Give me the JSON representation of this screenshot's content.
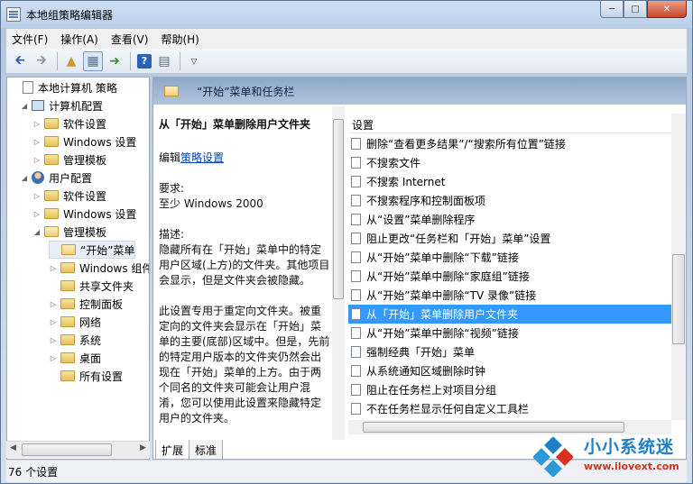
{
  "window": {
    "title": "本地组策略编辑器"
  },
  "menu": [
    "文件(F)",
    "操作(A)",
    "查看(V)",
    "帮助(H)"
  ],
  "tree": [
    {
      "label": "本地计算机 策略",
      "level": 0,
      "icon": "doc-icon",
      "tw": ""
    },
    {
      "label": "计算机配置",
      "level": 1,
      "icon": "computer-icon",
      "tw": "◢"
    },
    {
      "label": "软件设置",
      "level": 2,
      "icon": "folder-icon",
      "tw": "▷"
    },
    {
      "label": "Windows 设置",
      "level": 2,
      "icon": "folder-icon",
      "tw": "▷"
    },
    {
      "label": "管理模板",
      "level": 2,
      "icon": "folder-icon",
      "tw": "▷"
    },
    {
      "label": "用户配置",
      "level": 1,
      "icon": "user-icon",
      "tw": "◢"
    },
    {
      "label": "软件设置",
      "level": 2,
      "icon": "folder-icon",
      "tw": "▷"
    },
    {
      "label": "Windows 设置",
      "level": 2,
      "icon": "folder-icon",
      "tw": "▷"
    },
    {
      "label": "管理模板",
      "level": 2,
      "icon": "folder-open-icon",
      "tw": "◢"
    },
    {
      "label": "“开始”菜单",
      "level": 3,
      "icon": "folder-open-icon",
      "tw": "",
      "selected": true
    },
    {
      "label": "Windows 组件",
      "level": 3,
      "icon": "folder-icon",
      "tw": "▷"
    },
    {
      "label": "共享文件夹",
      "level": 3,
      "icon": "folder-icon",
      "tw": ""
    },
    {
      "label": "控制面板",
      "level": 3,
      "icon": "folder-icon",
      "tw": "▷"
    },
    {
      "label": "网络",
      "level": 3,
      "icon": "folder-icon",
      "tw": "▷"
    },
    {
      "label": "系统",
      "level": 3,
      "icon": "folder-icon",
      "tw": "▷"
    },
    {
      "label": "桌面",
      "level": 3,
      "icon": "folder-icon",
      "tw": "▷"
    },
    {
      "label": "所有设置",
      "level": 3,
      "icon": "settings-folder-icon",
      "tw": ""
    }
  ],
  "right": {
    "header": "“开始”菜单和任务栏",
    "desc_title": "从「开始」菜单删除用户文件夹",
    "edit_prefix": "编辑",
    "edit_link": "策略设置",
    "req_label": "要求:",
    "req_value": "至少 Windows 2000",
    "desc_label": "描述:",
    "desc_body": "隐藏所有在「开始」菜单中的特定用户区域(上方)的文件夹。其他项目会显示，但是文件夹会被隐藏。",
    "desc_body2": "此设置专用于重定向文件夹。被重定向的文件夹会显示在「开始」菜单的主要(底部)区域中。但是，先前的特定用户版本的文件夹仍然会出现在「开始」菜单的上方。由于两个同名的文件夹可能会让用户混淆，您可以使用此设置来隐藏特定用户的文件夹。",
    "list_header": "设置",
    "items": [
      "删除“查看更多结果”/“搜索所有位置”链接",
      "不搜索文件",
      "不搜索 Internet",
      "不搜索程序和控制面板项",
      "从“设置”菜单删除程序",
      "阻止更改“任务栏和「开始」菜单”设置",
      "从“开始”菜单中删除“下载”链接",
      "从“开始”菜单中删除“家庭组”链接",
      "从“开始”菜单中删除“TV 录像”链接",
      "从「开始」菜单删除用户文件夹",
      "从“开始”菜单中删除“视频”链接",
      "强制经典「开始」菜单",
      "从系统通知区域删除时钟",
      "阻止在任务栏上对项目分组",
      "不在任务栏显示任何自定义工具栏"
    ],
    "selected_index": 9,
    "tabs": [
      "扩展",
      "标准"
    ]
  },
  "status": "76 个设置",
  "watermark": {
    "title": "小小系统迷",
    "url": "www.ilovext.com"
  }
}
